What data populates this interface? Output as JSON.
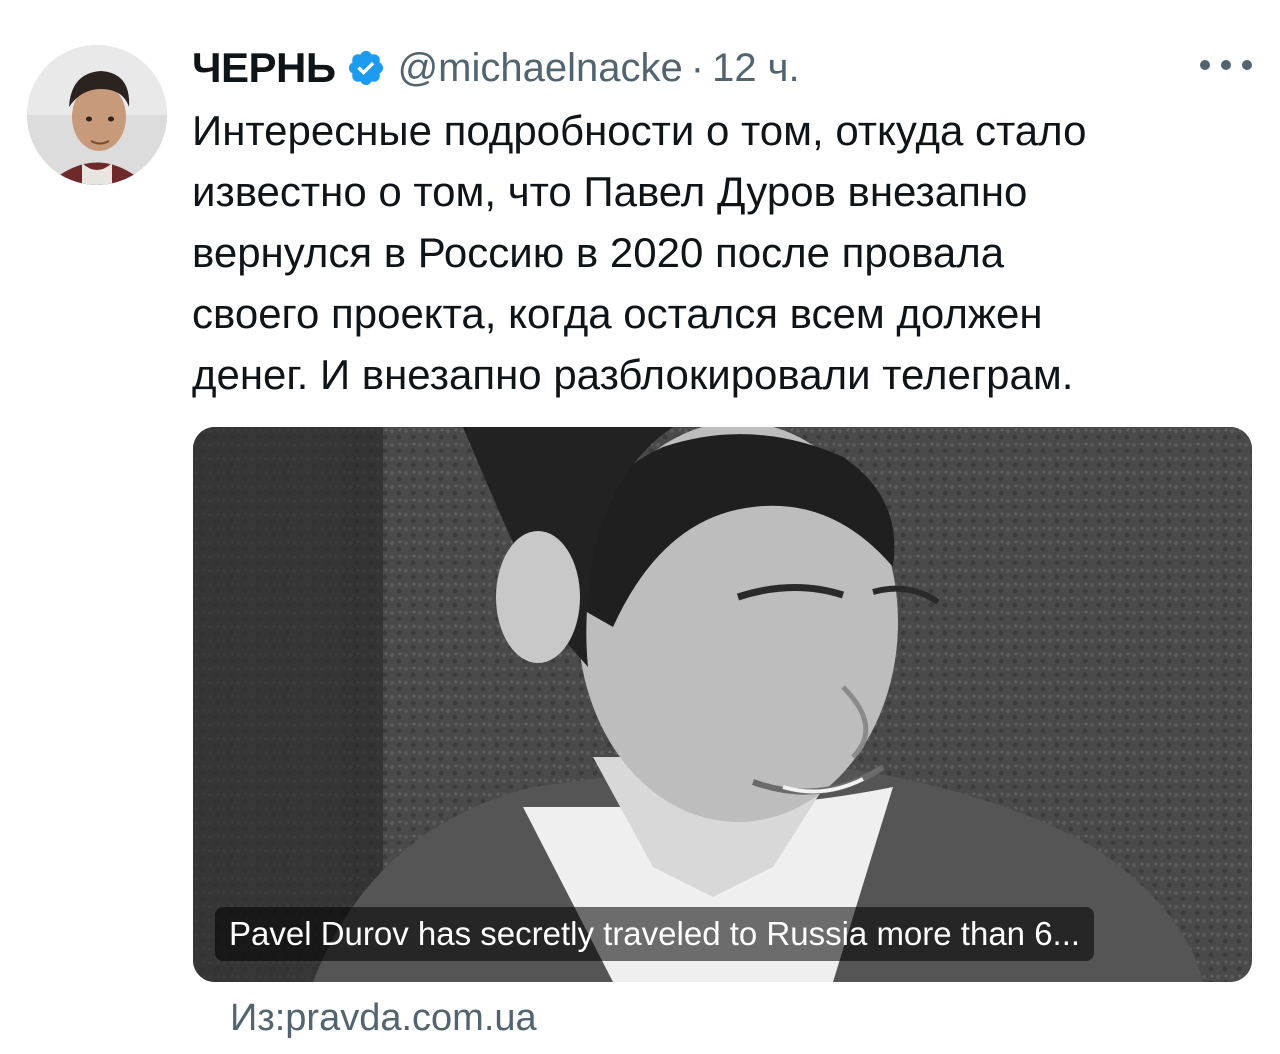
{
  "tweet": {
    "author": {
      "display_name": "ЧЕРНЬ",
      "handle": "@michaelnacke",
      "verified_icon": "verified-badge-icon",
      "verified_color": "#1d9bf0"
    },
    "separator": "·",
    "time": "12 ч.",
    "more_icon": "more-horizontal-icon",
    "text": "Интересные подробности о том, откуда стало\nизвестно о том, что Павел Дуров внезапно\nвернулся в Россию в 2020 после провала\nсвоего проекта, когда остался всем должен\nденег. И внезапно разблокировали телеграм.",
    "card": {
      "title": "Pavel Durov has secretly traveled to Russia more than 6...",
      "source": "Из:pravda.com.ua"
    }
  }
}
